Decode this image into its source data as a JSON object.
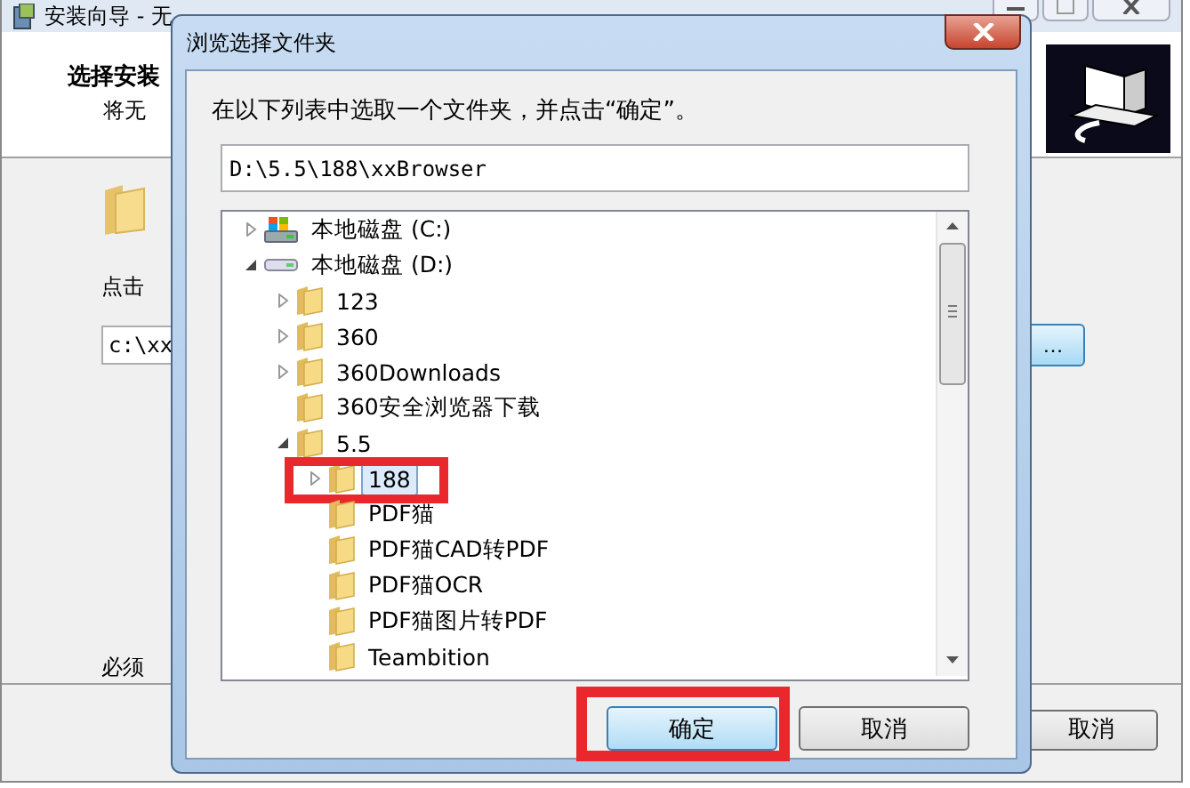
{
  "installer": {
    "title": "安装向导 - 无",
    "heading": "选择安装",
    "subheading": "将无",
    "prompt": "点击",
    "path_value": "c:\\xx",
    "browse_button": "…",
    "note": "必须",
    "cancel_button": "取消"
  },
  "dialog": {
    "title": "浏览选择文件夹",
    "instruction": "在以下列表中选取一个文件夹，并点击“确定”。",
    "path_value": "D:\\5.5\\188\\xxBrowser",
    "tree": [
      {
        "label": "本地磁盘 (C:)",
        "kind": "system-drive",
        "expandable": true,
        "expanded": false,
        "selected": false,
        "highlighted": false
      },
      {
        "label": "本地磁盘 (D:)",
        "kind": "drive",
        "expandable": true,
        "expanded": true,
        "selected": false,
        "highlighted": false,
        "children": [
          {
            "label": "123",
            "kind": "folder",
            "expandable": true,
            "expanded": false,
            "selected": false,
            "highlighted": false
          },
          {
            "label": "360",
            "kind": "folder",
            "expandable": true,
            "expanded": false,
            "selected": false,
            "highlighted": false
          },
          {
            "label": "360Downloads",
            "kind": "folder",
            "expandable": true,
            "expanded": false,
            "selected": false,
            "highlighted": false
          },
          {
            "label": "360安全浏览器下载",
            "kind": "folder",
            "expandable": false,
            "selected": false,
            "highlighted": false
          },
          {
            "label": "5.5",
            "kind": "folder",
            "expandable": true,
            "expanded": true,
            "selected": false,
            "highlighted": false,
            "children": [
              {
                "label": "188",
                "kind": "folder",
                "expandable": true,
                "expanded": false,
                "selected": true,
                "highlighted": true
              },
              {
                "label": "PDF猫",
                "kind": "folder",
                "expandable": false,
                "selected": false,
                "highlighted": false
              },
              {
                "label": "PDF猫CAD转PDF",
                "kind": "folder",
                "expandable": false,
                "selected": false,
                "highlighted": false
              },
              {
                "label": "PDF猫OCR",
                "kind": "folder",
                "expandable": false,
                "selected": false,
                "highlighted": false
              },
              {
                "label": "PDF猫图片转PDF",
                "kind": "folder",
                "expandable": false,
                "selected": false,
                "highlighted": false
              },
              {
                "label": "Teambition",
                "kind": "folder",
                "expandable": false,
                "selected": false,
                "highlighted": false
              }
            ]
          }
        ]
      }
    ],
    "buttons": [
      {
        "label": "确定",
        "kind": "default",
        "highlighted": true
      },
      {
        "label": "取消",
        "kind": "normal",
        "highlighted": false
      }
    ]
  }
}
